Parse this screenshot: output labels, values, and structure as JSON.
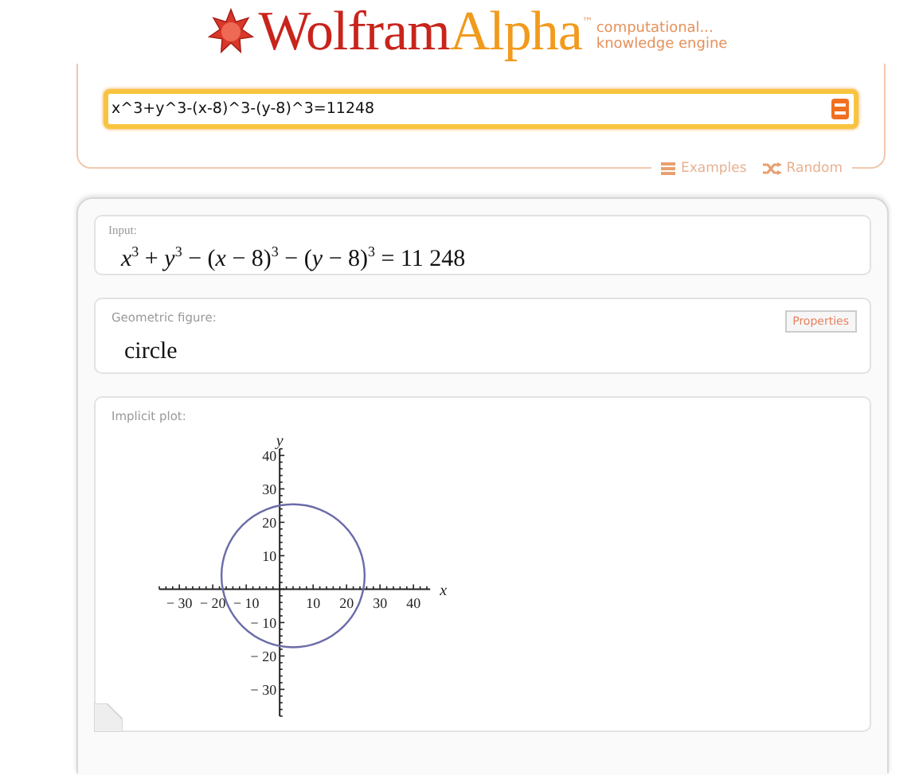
{
  "logo": {
    "word_1": "Wolfram",
    "word_2": "Alpha",
    "trademark": "™",
    "tagline": [
      "computational...",
      "knowledge engine"
    ]
  },
  "search": {
    "value": "x^3+y^3-(x-8)^3-(y-8)^3=11248"
  },
  "links": [
    {
      "kind": "examples",
      "label": "Examples"
    },
    {
      "kind": "random",
      "label": "Random"
    }
  ],
  "pods": [
    {
      "kind": "math",
      "title": "Input:",
      "content": "*x*$^{3}$ + *y*$^{3}$ − (*x* − 8)$^{3}$ − (*y* − 8)$^{3}$ = 11 248"
    },
    {
      "kind": "text",
      "title": "Geometric figure:",
      "content": "circle",
      "button": "Properties"
    },
    {
      "kind": "plot",
      "title": "Implicit plot:",
      "chart_data": {
        "type": "line",
        "xlabel": "x",
        "ylabel": "y",
        "xlim": [
          -36,
          45
        ],
        "ylim": [
          -38,
          42
        ],
        "xticks": [
          {
            "value": -30,
            "label": "− 30"
          },
          {
            "value": -20,
            "label": "− 20"
          },
          {
            "value": -10,
            "label": "− 10"
          },
          10,
          20,
          30,
          40
        ],
        "yticks": [
          {
            "value": -30,
            "label": "− 30"
          },
          {
            "value": -20,
            "label": "− 20"
          },
          {
            "value": -10,
            "label": "− 10"
          },
          10,
          20,
          30,
          40
        ]
      }
    }
  ]
}
